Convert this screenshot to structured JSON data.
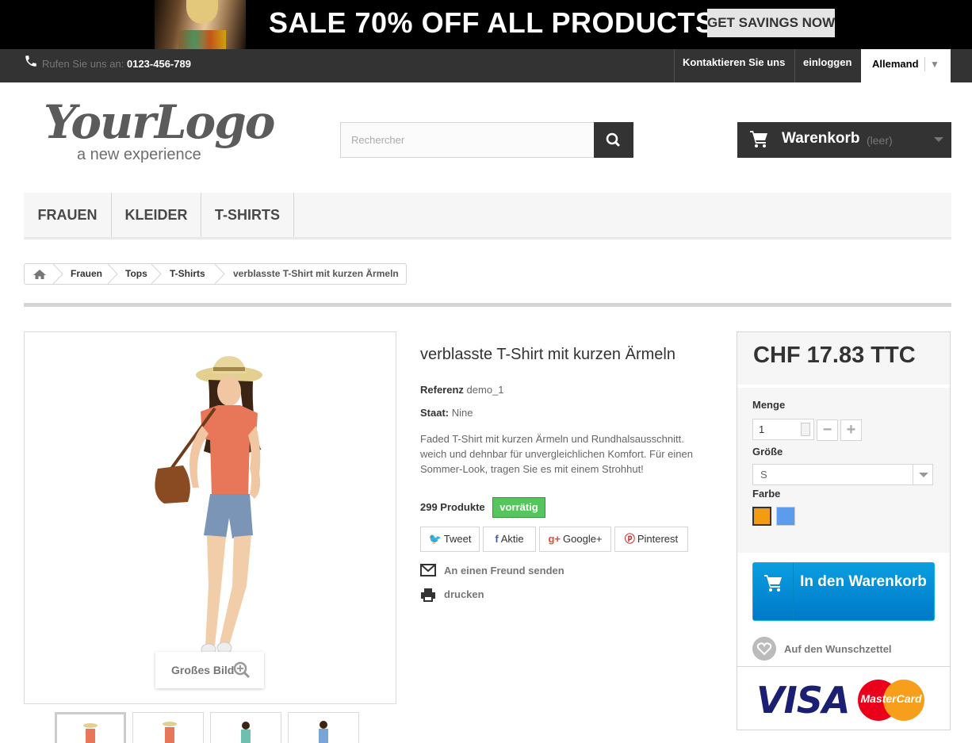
{
  "banner": {
    "title": "SALE 70% OFF ALL PRODUCTS",
    "button": "GET SAVINGS NOW"
  },
  "topbar": {
    "call_label": "Rufen Sie uns an:",
    "phone": "0123-456-789",
    "contact": "Kontaktieren Sie uns",
    "login": "einloggen",
    "language": "Allemand"
  },
  "header": {
    "logo_script": "YourLogo",
    "logo_tagline": "a new experience",
    "search_placeholder": "Rechercher",
    "cart_label": "Warenkorb",
    "cart_status": "(leer)"
  },
  "menu": [
    "FRAUEN",
    "KLEIDER",
    "T-SHIRTS"
  ],
  "breadcrumb": [
    "Frauen",
    "Tops",
    "T-Shirts",
    "verblasste T-Shirt mit kurzen Ärmeln"
  ],
  "product": {
    "title": "verblasste T-Shirt mit kurzen Ärmeln",
    "reference_label": "Referenz",
    "reference": "demo_1",
    "condition_label": "Staat:",
    "condition": "Nine",
    "description": "Faded T-Shirt mit kurzen Ärmeln und Rundhalsausschnitt. weich und dehnbar für unvergleichlichen Komfort. Für einen Sommer-Look, tragen Sie es mit einem Strohhut!",
    "stock_count": "299 Produkte",
    "stock_status": "vorrätig",
    "zoom_label": "Großes Bild",
    "share": {
      "tweet": "Tweet",
      "facebook": "Aktie",
      "google": "Google+",
      "pinterest": "Pinterest"
    },
    "send_friend": "An einen Freund senden",
    "print": "drucken"
  },
  "buy_box": {
    "price": "CHF 17.83 TTC",
    "quantity_label": "Menge",
    "quantity_value": "1",
    "size_label": "Größe",
    "size_value": "S",
    "color_label": "Farbe",
    "colors": [
      "#f39c11",
      "#5d9cec"
    ],
    "add_to_cart": "In den Warenkorb",
    "wishlist": "Auf den Wunschzettel",
    "visa": "VISA",
    "mastercard": "MasterCard"
  },
  "colors": {
    "accent": "#0a9ee0",
    "in_stock": "#55c65e",
    "dark": "#333333"
  }
}
